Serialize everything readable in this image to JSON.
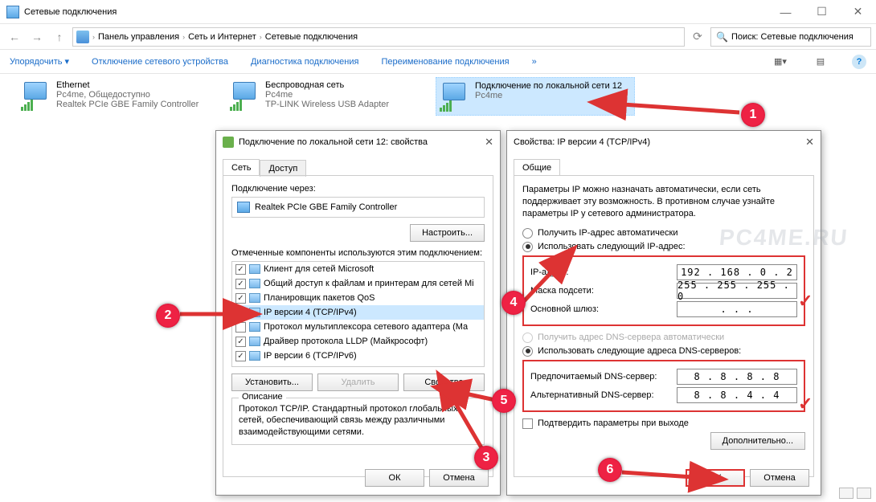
{
  "window": {
    "title": "Сетевые подключения"
  },
  "sysbuttons": {
    "min": "—",
    "max": "☐",
    "close": "✕"
  },
  "breadcrumb": {
    "p1": "Панель управления",
    "p2": "Сеть и Интернет",
    "p3": "Сетевые подключения"
  },
  "search": {
    "placeholder": "Поиск: Сетевые подключения"
  },
  "cmdbar": {
    "organize": "Упорядочить ▾",
    "disable": "Отключение сетевого устройства",
    "diag": "Диагностика подключения",
    "rename": "Переименование подключения",
    "more": "»"
  },
  "connections": [
    {
      "name": "Ethernet",
      "sub1": "Pc4me, Общедоступно",
      "sub2": "Realtek PCIe GBE Family Controller"
    },
    {
      "name": "Беспроводная сеть",
      "sub1": "Pc4me",
      "sub2": "TP-LINK Wireless USB Adapter"
    },
    {
      "name": "Подключение по локальной сети 12",
      "sub1": "",
      "sub2": "Pc4me"
    }
  ],
  "dlg1": {
    "title": "Подключение по локальной сети 12: свойства",
    "tab_net": "Сеть",
    "tab_access": "Доступ",
    "conn_via": "Подключение через:",
    "adapter": "Realtek PCIe GBE Family Controller",
    "configure": "Настроить...",
    "components_lbl": "Отмеченные компоненты используются этим подключением:",
    "items": [
      {
        "c": true,
        "t": "Клиент для сетей Microsoft"
      },
      {
        "c": true,
        "t": "Общий доступ к файлам и принтерам для сетей Mi"
      },
      {
        "c": true,
        "t": "Планировщик пакетов QoS"
      },
      {
        "c": true,
        "t": "IP версии 4 (TCP/IPv4)"
      },
      {
        "c": false,
        "t": "Протокол мультиплексора сетевого адаптера (Ма"
      },
      {
        "c": true,
        "t": "Драйвер протокола LLDP (Майкрософт)"
      },
      {
        "c": true,
        "t": "IP версии 6 (TCP/IPv6)"
      }
    ],
    "install": "Установить...",
    "remove": "Удалить",
    "props": "Свойства",
    "desc_legend": "Описание",
    "desc": "Протокол TCP/IP. Стандартный протокол глобальных сетей, обеспечивающий связь между различными взаимодействующими сетями.",
    "ok": "ОК",
    "cancel": "Отмена"
  },
  "dlg2": {
    "title": "Свойства: IP версии 4 (TCP/IPv4)",
    "tab": "Общие",
    "para": "Параметры IP можно назначать автоматически, если сеть поддерживает эту возможность. В противном случае узнайте параметры IP у сетевого администратора.",
    "r_auto_ip": "Получить IP-адрес автоматически",
    "r_man_ip": "Использовать следующий IP-адрес:",
    "ip_lbl": "IP-адрес:",
    "ip_val": "192 . 168 .  0  .  2",
    "mask_lbl": "Маска подсети:",
    "mask_val": "255 . 255 . 255 .  0",
    "gw_lbl": "Основной шлюз:",
    "gw_val": ".       .       .",
    "r_auto_dns": "Получить адрес DNS-сервера автоматически",
    "r_man_dns": "Использовать следующие адреса DNS-серверов:",
    "dns1_lbl": "Предпочитаемый DNS-сервер:",
    "dns1_val": "8  .  8  .  8  .  8",
    "dns2_lbl": "Альтернативный DNS-сервер:",
    "dns2_val": "8  .  8  .  4  .  4",
    "confirm": "Подтвердить параметры при выходе",
    "advanced": "Дополнительно...",
    "ok": "ОК",
    "cancel": "Отмена"
  },
  "markers": {
    "1": "1",
    "2": "2",
    "3": "3",
    "4": "4",
    "5": "5",
    "6": "6"
  },
  "watermark": "PC4ME.RU"
}
